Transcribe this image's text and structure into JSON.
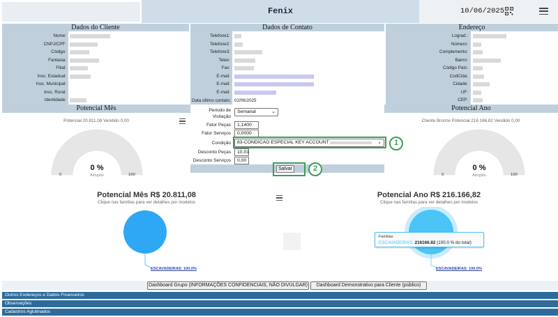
{
  "header": {
    "title": "Fenix",
    "date": "10/06/2025",
    "qr_icon": "qr-code-icon",
    "menu_icon": "hamburger-menu-icon"
  },
  "cliente": {
    "heading": "Dados do Cliente",
    "labels": [
      "Nome:",
      "CNPJ/CPF:",
      "Código:",
      "Fantasia:",
      "Filial:",
      "Insc. Estadual:",
      "Insc. Municipal:",
      "Insc. Rural:",
      "Identidade:"
    ]
  },
  "contato": {
    "heading": "Dados de Contato",
    "labels": [
      "Telefone1:",
      "Telefone2:",
      "Telefone3:",
      "Telex:",
      "Fax:",
      "E-mail:",
      "E-mail:",
      "E-mail:"
    ],
    "ultimo_label": "Data último contato:",
    "ultimo_value": "02/06/2025"
  },
  "endereco": {
    "heading": "Endereço",
    "labels": [
      "Lograd.:",
      "Número:",
      "Complemento:",
      "Bairro:",
      "Código País:",
      "CodCida:",
      "Cidade:",
      "UF:",
      "CEP:"
    ]
  },
  "form": {
    "periodo_label": "Periodo de Visitação",
    "periodo_value": "Semanal",
    "fator_pecas_label": "Fator Peças",
    "fator_pecas_value": "1,1400",
    "fator_servicos_label": "Fator Serviços",
    "fator_servicos_value": "0,0000",
    "condicao_label": "Condição",
    "condicao_value": "83-CONDICAO ESPECIAL KEY ACCOUNT -",
    "desc_pecas_label": "Desconto Peças",
    "desc_pecas_value": "10,01",
    "desc_servicos_label": "Desconto Serviços",
    "desc_servicos_value": "0,00",
    "salvar_label": "Salvar",
    "callout1": "1",
    "callout2": "2"
  },
  "potencial_mes": {
    "heading": "Potencial Mês",
    "subtitle": "Potencial 20.811,08 Vendido 0,00",
    "gauge_value": "0 %",
    "gauge_sub": "Atingido",
    "gauge_min": "0",
    "gauge_max": "100",
    "big_title": "Potencial Mês R$ 20.811,08",
    "big_sub": "Clique nas famílias para ver detalhes por modelos",
    "pie_label": "ESCAVADEIRAS: 100.0%",
    "pie_color": "#2ea8f5"
  },
  "potencial_ano": {
    "heading": "Potencial Ano",
    "subtitle": "Cliente Bronze Potencial 216.166,82 Vendido 0,00",
    "gauge_value": "0 %",
    "gauge_sub": "Atingido",
    "gauge_min": "0",
    "gauge_max": "100",
    "big_title": "Potencial Ano R$ 216.166,82",
    "big_sub": "Clique nas famílias para ver detalhes por modelos",
    "pie_label": "ESCAVADEIRAS: 100.0%",
    "pie_color": "#4cc4f8",
    "tooltip_title": "Familias",
    "tooltip_series": "ESCAVADEIRAS:",
    "tooltip_value": "216166.82",
    "tooltip_pct": "(100.0 % do total)"
  },
  "buttons": {
    "dash_grupo": "Dashboard Grupo (INFORMAÇÕES CONFIDENCIAIS, NÃO DIVULGAR)",
    "dash_demo": "Dashboard Demonstrativo para Cliente (público)"
  },
  "footer": [
    "Outros Endereços e Dados Financeiros",
    "Observações",
    "Cadastros Aglutinados"
  ]
}
